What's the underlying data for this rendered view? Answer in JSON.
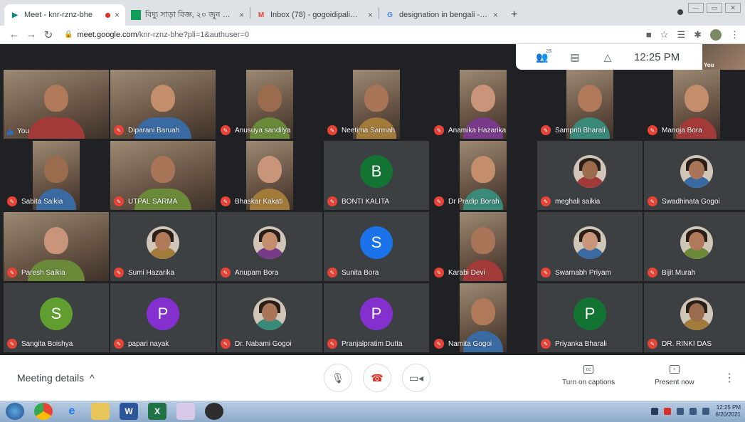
{
  "browser": {
    "tabs": [
      {
        "title": "Meet - knr-rznz-bhe",
        "favicon": "meet-icon",
        "color": "#00897b",
        "recording": true,
        "active": true
      },
      {
        "title": "বিদ্যু সাড়া বিজ্ঞ, ২০ জুন ২০২১ - Goo",
        "favicon": "sheets-icon",
        "color": "#0f9d58",
        "active": false
      },
      {
        "title": "Inbox (78) - gogoidipali@gmail",
        "favicon": "gmail-icon",
        "color": "#ea4335",
        "active": false
      },
      {
        "title": "designation in bengali - Google",
        "favicon": "google-icon",
        "color": "#4285f4",
        "active": false
      }
    ],
    "new_tab": "+",
    "close": "×",
    "url_host": "meet.google.com",
    "url_path": "/knr-rznz-bhe?pli=1&authuser=0"
  },
  "meet": {
    "participants_count": "28",
    "clock": "12:25 PM",
    "self_label": "You",
    "tiles": [
      {
        "name": "You",
        "kind": "video",
        "self": true,
        "muted": false
      },
      {
        "name": "Diparani Baruah",
        "kind": "video",
        "muted": true
      },
      {
        "name": "Anusuya sandilya",
        "kind": "video-narrow",
        "muted": true
      },
      {
        "name": "Neetima Sarmah",
        "kind": "video-narrow",
        "muted": true
      },
      {
        "name": "Anamika Hazarika",
        "kind": "video-narrow",
        "muted": true
      },
      {
        "name": "Sampriti Bharali",
        "kind": "video-narrow",
        "muted": true
      },
      {
        "name": "Manoja Bora",
        "kind": "video-narrow",
        "muted": true
      },
      {
        "name": "Sabita Saikia",
        "kind": "video-narrow",
        "muted": true
      },
      {
        "name": "UTPAL SARMA",
        "kind": "video",
        "muted": true
      },
      {
        "name": "Bhaskar Kakati",
        "kind": "video-narrow",
        "muted": true
      },
      {
        "name": "BONTI KALITA",
        "kind": "letter",
        "letter": "B",
        "color": "#137333",
        "muted": true
      },
      {
        "name": "Dr Pradip Borah",
        "kind": "video-narrow",
        "muted": true
      },
      {
        "name": "meghali saikia",
        "kind": "photo",
        "muted": true
      },
      {
        "name": "Swadhinata Gogoi",
        "kind": "photo",
        "muted": true
      },
      {
        "name": "Paresh Saikia",
        "kind": "video",
        "muted": true
      },
      {
        "name": "Sumi Hazarika",
        "kind": "photo",
        "muted": true
      },
      {
        "name": "Anupam Bora",
        "kind": "photo",
        "muted": true
      },
      {
        "name": "Sunita Bora",
        "kind": "letter",
        "letter": "S",
        "color": "#1a73e8",
        "muted": true
      },
      {
        "name": "Karabi Devi",
        "kind": "video-narrow",
        "muted": true
      },
      {
        "name": "Swarnabh Priyam",
        "kind": "photo",
        "muted": true
      },
      {
        "name": "Bijit Murah",
        "kind": "photo",
        "muted": true
      },
      {
        "name": "Sangita Boishya",
        "kind": "letter",
        "letter": "S",
        "color": "#5f9e2f",
        "muted": true
      },
      {
        "name": "papari nayak",
        "kind": "letter",
        "letter": "P",
        "color": "#8430ce",
        "muted": true
      },
      {
        "name": "Dr. Nabami Gogoi",
        "kind": "photo",
        "muted": true
      },
      {
        "name": "Pranjalpratim Dutta",
        "kind": "letter",
        "letter": "P",
        "color": "#8430ce",
        "muted": true
      },
      {
        "name": "Namita Gogoi",
        "kind": "video-narrow",
        "muted": true
      },
      {
        "name": "Priyanka Bharali",
        "kind": "letter",
        "letter": "P",
        "color": "#137333",
        "muted": true
      },
      {
        "name": "DR. RINKI DAS",
        "kind": "photo",
        "muted": true
      }
    ]
  },
  "controls": {
    "meeting_details": "Meeting details",
    "captions": "Turn on captions",
    "present": "Present now"
  },
  "taskbar": {
    "apps": [
      "start-orb",
      "chrome-icon",
      "ie-icon",
      "explorer-icon",
      "word-icon",
      "excel-icon",
      "paint-icon",
      "obs-icon"
    ],
    "time": "12:25 PM",
    "date": "6/20/2021"
  }
}
